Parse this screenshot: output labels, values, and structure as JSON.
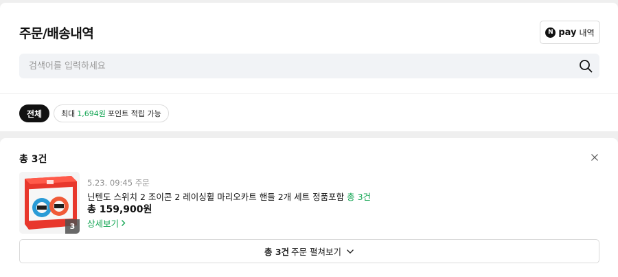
{
  "header": {
    "title": "주문/배송내역",
    "npay_badge": "N",
    "npay_pay": "pay",
    "npay_label": "내역"
  },
  "search": {
    "placeholder": "검색어를 입력하세요",
    "value": ""
  },
  "filters": {
    "all_label": "전체",
    "point_prefix": "최대",
    "point_amount": "1,694원",
    "point_suffix": "포인트 적립 가능"
  },
  "orders": {
    "total_prefix": "총",
    "total_count": "3건",
    "item": {
      "thumb_count": "3",
      "date": "5.23. 09:45 주문",
      "name": "닌텐도 스위치 2 조이콘 2 레이싱휠 마리오카트 핸들 2개 세트 정품포함",
      "name_count": "총 3건",
      "price": "총 159,900원",
      "detail_label": "상세보기"
    },
    "expand": {
      "count": "총 3건",
      "label": "주문 펼쳐보기"
    }
  },
  "colors": {
    "accent": "#10a451",
    "chip_dark": "#111111",
    "search_bg": "#f1f3f6"
  }
}
